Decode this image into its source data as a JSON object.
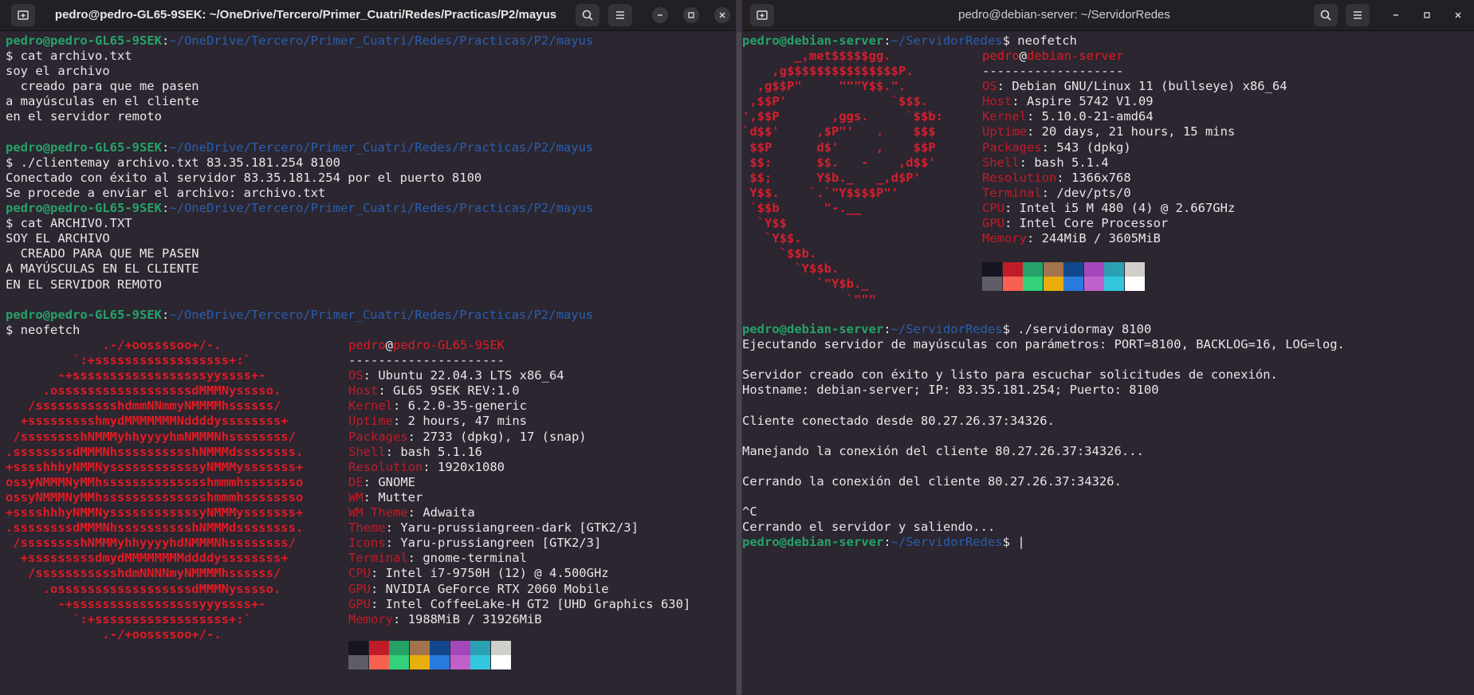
{
  "left_window": {
    "title": "pedro@pedro-GL65-9SEK: ~/OneDrive/Tercero/Primer_Cuatri/Redes/Practicas/P2/mayus",
    "prompt_user": "pedro@pedro-GL65-9SEK",
    "prompt_path": "~/OneDrive/Tercero/Primer_Cuatri/Redes/Practicas/P2/mayus",
    "lines": [
      {
        "type": "prompt"
      },
      {
        "type": "text",
        "text": "$ cat archivo.txt"
      },
      {
        "type": "text",
        "text": "soy el archivo"
      },
      {
        "type": "text",
        "text": "  creado para que me pasen"
      },
      {
        "type": "text",
        "text": "a mayúsculas en el cliente"
      },
      {
        "type": "text",
        "text": "en el servidor remoto"
      },
      {
        "type": "blank"
      },
      {
        "type": "prompt"
      },
      {
        "type": "text",
        "text": "$ ./clientemay archivo.txt 83.35.181.254 8100"
      },
      {
        "type": "text",
        "text": "Conectado con éxito al servidor 83.35.181.254 por el puerto 8100"
      },
      {
        "type": "text",
        "text": "Se procede a enviar el archivo: archivo.txt"
      },
      {
        "type": "prompt"
      },
      {
        "type": "text",
        "text": "$ cat ARCHIVO.TXT"
      },
      {
        "type": "text",
        "text": "SOY EL ARCHIVO"
      },
      {
        "type": "text",
        "text": "  CREADO PARA QUE ME PASEN"
      },
      {
        "type": "text",
        "text": "A MAYÚSCULAS EN EL CLIENTE"
      },
      {
        "type": "text",
        "text": "EN EL SERVIDOR REMOTO"
      },
      {
        "type": "blank"
      },
      {
        "type": "prompt"
      },
      {
        "type": "text",
        "text": "$ neofetch"
      }
    ],
    "neofetch_art": [
      "             .-/+oossssoo+/-.",
      "         `:+ssssssssssssssssss+:`",
      "       -+ssssssssssssssssssyyssss+-",
      "     .ossssssssssssssssssdMMMNysssso.",
      "   /ssssssssssshdmmNNmmyNMMMMhssssss/",
      "  +ssssssssshmydMMMMMMMNddddyssssssss+",
      " /sssssssshNMMMyhhyyyyhmNMMMNhssssssss/",
      ".ssssssssdMMMNhsssssssssshNMMMdssssssss.",
      "+sssshhhyNMMNyssssssssssssyNMMMysssssss+",
      "ossyNMMMNyMMhsssssssssssssshmmmhssssssso",
      "ossyNMMMNyMMhsssssssssssssshmmmhssssssso",
      "+sssshhhyNMMNyssssssssssssyNMMMysssssss+",
      ".ssssssssdMMMNhsssssssssshNMMMdssssssss.",
      " /sssssssshNMMMyhhyyyyhdNMMMNhssssssss/",
      "  +sssssssssdmydMMMMMMMMddddyssssssss+",
      "   /ssssssssssshdmNNNNmyNMMMMhssssss/",
      "     .ossssssssssssssssssdMMMNysssso.",
      "       -+sssssssssssssssssyyyssss+-",
      "         `:+ssssssssssssssssss+:`",
      "             .-/+oossssoo+/-."
    ],
    "neofetch_host": "pedro-GL65-9SEK",
    "neofetch_user": "pedro",
    "separator": "---------------------",
    "info": [
      {
        "key": "OS",
        "value": "Ubuntu 22.04.3 LTS x86_64"
      },
      {
        "key": "Host",
        "value": "GL65 9SEK REV:1.0"
      },
      {
        "key": "Kernel",
        "value": "6.2.0-35-generic"
      },
      {
        "key": "Uptime",
        "value": "2 hours, 47 mins"
      },
      {
        "key": "Packages",
        "value": "2733 (dpkg), 17 (snap)"
      },
      {
        "key": "Shell",
        "value": "bash 5.1.16"
      },
      {
        "key": "Resolution",
        "value": "1920x1080"
      },
      {
        "key": "DE",
        "value": "GNOME"
      },
      {
        "key": "WM",
        "value": "Mutter"
      },
      {
        "key": "WM Theme",
        "value": "Adwaita"
      },
      {
        "key": "Theme",
        "value": "Yaru-prussiangreen-dark [GTK2/3]"
      },
      {
        "key": "Icons",
        "value": "Yaru-prussiangreen [GTK2/3]"
      },
      {
        "key": "Terminal",
        "value": "gnome-terminal"
      },
      {
        "key": "CPU",
        "value": "Intel i7-9750H (12) @ 4.500GHz"
      },
      {
        "key": "GPU",
        "value": "NVIDIA GeForce RTX 2060 Mobile"
      },
      {
        "key": "GPU",
        "value": "Intel CoffeeLake-H GT2 [UHD Graphics 630]"
      },
      {
        "key": "Memory",
        "value": "1988MiB / 31926MiB"
      }
    ]
  },
  "right_window": {
    "title": "pedro@debian-server: ~/ServidorRedes",
    "prompt_user": "pedro@debian-server",
    "prompt_path": "~/ServidorRedes",
    "first_command": "$ neofetch",
    "neofetch_art": [
      "       _,met$$$$$gg.",
      "    ,g$$$$$$$$$$$$$$$P.",
      "  ,g$$P\"     \"\"\"Y$$.\".",
      " ,$$P'              `$$$.",
      "',$$P       ,ggs.     `$$b:",
      "`d$$'     ,$P\"'   .    $$$",
      " $$P      d$'     ,    $$P",
      " $$:      $$.   -    ,d$$'",
      " $$;      Y$b._   _,d$P'",
      " Y$$.    `.`\"Y$$$$P\"'",
      " `$$b      \"-.__",
      "  `Y$$",
      "   `Y$$.",
      "     `$$b.",
      "       `Y$$b.",
      "          `\"Y$b._",
      "              `\"\"\""
    ],
    "neofetch_user": "pedro",
    "neofetch_host": "debian-server",
    "separator": "-------------------",
    "info": [
      {
        "key": "OS",
        "value": "Debian GNU/Linux 11 (bullseye) x86_64"
      },
      {
        "key": "Host",
        "value": "Aspire 5742 V1.09"
      },
      {
        "key": "Kernel",
        "value": "5.10.0-21-amd64"
      },
      {
        "key": "Uptime",
        "value": "20 days, 21 hours, 15 mins"
      },
      {
        "key": "Packages",
        "value": "543 (dpkg)"
      },
      {
        "key": "Shell",
        "value": "bash 5.1.4"
      },
      {
        "key": "Resolution",
        "value": "1366x768"
      },
      {
        "key": "Terminal",
        "value": "/dev/pts/0"
      },
      {
        "key": "CPU",
        "value": "Intel i5 M 480 (4) @ 2.667GHz"
      },
      {
        "key": "GPU",
        "value": "Intel Core Processor"
      },
      {
        "key": "Memory",
        "value": "244MiB / 3605MiB"
      }
    ],
    "second_command": "$ ./servidormay 8100",
    "output": [
      "Ejecutando servidor de mayúsculas con parámetros: PORT=8100, BACKLOG=16, LOG=log.",
      "",
      "Servidor creado con éxito y listo para escuchar solicitudes de conexión.",
      "Hostname: debian-server; IP: 83.35.181.254; Puerto: 8100",
      "",
      "Cliente conectado desde 80.27.26.37:34326.",
      "",
      "Manejando la conexión del cliente 80.27.26.37:34326...",
      "",
      "Cerrando la conexión del cliente 80.27.26.37:34326.",
      "",
      "^C",
      "Cerrando el servidor y saliendo..."
    ],
    "final_prompt_suffix": "$ "
  },
  "palette_top": [
    "#171421",
    "#c01c28",
    "#26a269",
    "#a2734c",
    "#12488b",
    "#a347ba",
    "#2aa1b3",
    "#d0cfcc"
  ],
  "palette_bottom": [
    "#5e5c64",
    "#f66151",
    "#33d17a",
    "#e9ad0c",
    "#2a7bde",
    "#c061cb",
    "#33c7de",
    "#ffffff"
  ],
  "icons": {
    "new_tab": "new-tab-icon",
    "search": "search-icon",
    "menu": "hamburger-menu-icon",
    "minimize": "minimize-icon",
    "maximize": "maximize-icon",
    "close": "close-icon"
  }
}
